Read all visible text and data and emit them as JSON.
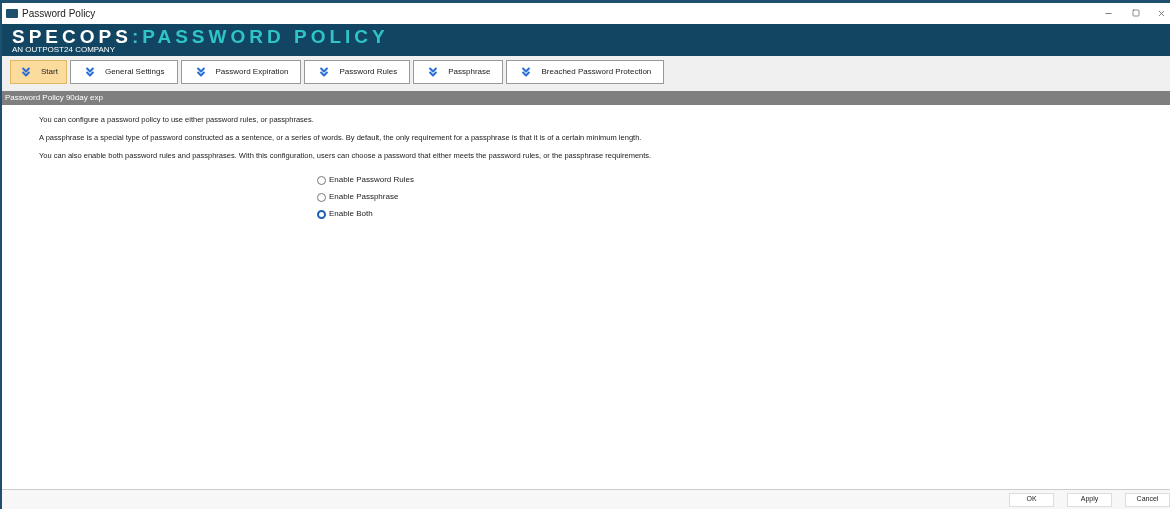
{
  "window": {
    "title": "Password Policy"
  },
  "banner": {
    "brand": "SPECOPS",
    "product": ":PASSWORD POLICY",
    "tagline": "AN OUTPOST24 COMPANY"
  },
  "tabs": [
    {
      "label": "Start",
      "selected": true
    },
    {
      "label": "General Settings",
      "selected": false
    },
    {
      "label": "Password Expiration",
      "selected": false
    },
    {
      "label": "Password Rules",
      "selected": false
    },
    {
      "label": "Passphrase",
      "selected": false
    },
    {
      "label": "Breached Password Protection",
      "selected": false
    }
  ],
  "policy_bar": {
    "title": "Password Policy 90day exp"
  },
  "paragraphs": [
    "You can configure a password policy to use either password rules, or passphrases.",
    "A passphrase is a special type of password constructed as a sentence, or a series of words. By default, the only requirement for a passphrase is that it is of a certain minimum length.",
    "You can also enable both password rules and passphrases. With this configuration, users can choose a password that either meets the password rules, or the passphrase requirements."
  ],
  "options": [
    {
      "label": "Enable Password Rules",
      "selected": false
    },
    {
      "label": "Enable Passphrase",
      "selected": false
    },
    {
      "label": "Enable Both",
      "selected": true
    }
  ],
  "buttons": [
    "OK",
    "Apply",
    "Cancel"
  ]
}
